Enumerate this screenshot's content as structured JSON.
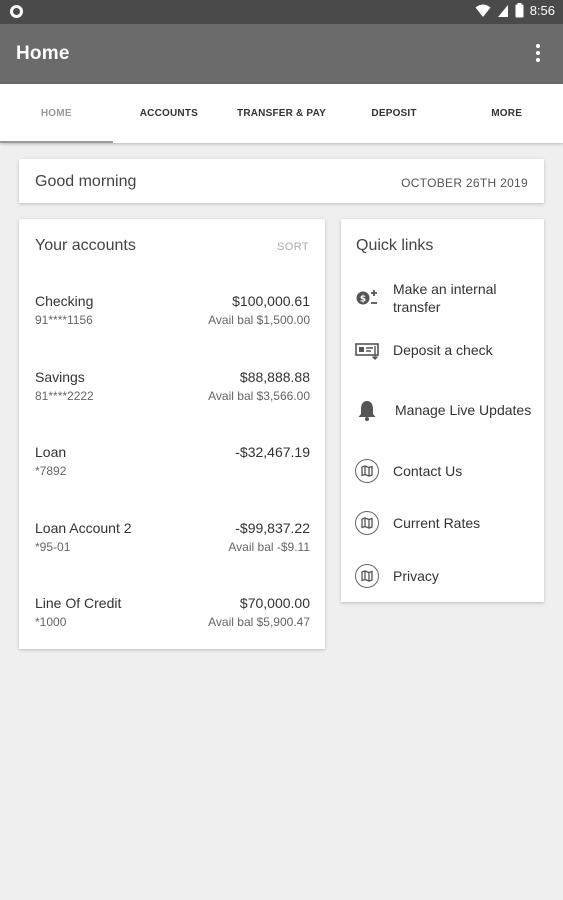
{
  "status_bar": {
    "time": "8:56"
  },
  "app_bar": {
    "title": "Home"
  },
  "tabs": [
    {
      "label": "HOME"
    },
    {
      "label": "ACCOUNTS"
    },
    {
      "label": "TRANSFER & PAY"
    },
    {
      "label": "DEPOSIT"
    },
    {
      "label": "MORE"
    }
  ],
  "greeting": {
    "text": "Good morning",
    "date": "OCTOBER 26TH 2019"
  },
  "accounts": {
    "title": "Your accounts",
    "sort_label": "SORT",
    "items": [
      {
        "name": "Checking",
        "number": "91****1156",
        "balance": "$100,000.61",
        "available": "Avail bal $1,500.00"
      },
      {
        "name": "Savings",
        "number": "81****2222",
        "balance": "$88,888.88",
        "available": "Avail bal $3,566.00"
      },
      {
        "name": "Loan",
        "number": "*7892",
        "balance": "-$32,467.19",
        "available": ""
      },
      {
        "name": "Loan Account 2",
        "number": "*95-01",
        "balance": "-$99,837.22",
        "available": "Avail bal -$9.11"
      },
      {
        "name": "Line Of Credit",
        "number": "*1000",
        "balance": "$70,000.00",
        "available": "Avail bal $5,900.47"
      }
    ]
  },
  "quick_links": {
    "title": "Quick links",
    "items": [
      {
        "label": "Make an internal transfer",
        "icon": "transfer-icon"
      },
      {
        "label": "Deposit a check",
        "icon": "check-deposit-icon"
      },
      {
        "label": "Manage Live Updates",
        "icon": "bell-icon"
      },
      {
        "label": "Contact Us",
        "icon": "map-icon"
      },
      {
        "label": "Current Rates",
        "icon": "map-icon"
      },
      {
        "label": "Privacy",
        "icon": "map-icon"
      }
    ]
  }
}
